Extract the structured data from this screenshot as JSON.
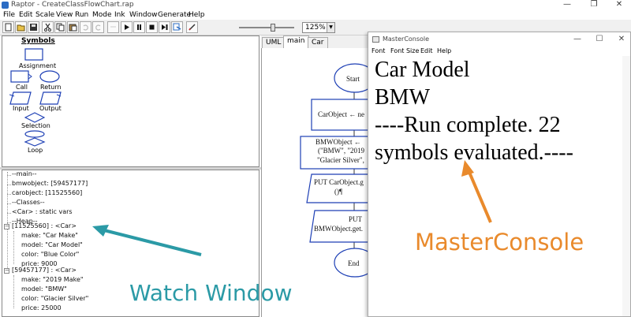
{
  "window": {
    "title": "Raptor - CreateClassFlowChart.rap"
  },
  "window_controls": {
    "minimize": "—",
    "maximize": "❐",
    "close": "✕"
  },
  "menu": [
    "File",
    "Edit",
    "Scale",
    "View",
    "Run",
    "Mode",
    "Ink",
    "Window",
    "Generate",
    "Help"
  ],
  "toolbar": {
    "buttons": [
      "new-icon",
      "open-icon",
      "save-icon",
      "cut-icon",
      "copy-icon",
      "paste-icon",
      "undo-icon",
      "redo-icon",
      "play-icon",
      "pause-icon",
      "stop-icon",
      "step-icon",
      "run-to-icon",
      "pen-icon"
    ],
    "zoom": "125%"
  },
  "symbols": {
    "heading": "Symbols",
    "items": [
      "Assignment",
      "Call",
      "Return",
      "Input",
      "Output",
      "Selection",
      "Loop"
    ]
  },
  "watch": {
    "lines": [
      "--main--",
      "bmwobject: [59457177]",
      "carobject: [11525560]",
      "--Classes--",
      "<Car> : static vars",
      "--Heap--",
      "[11525560] : <Car>",
      "make: \"Car Make\"",
      "model: \"Car Model\"",
      "color: \"Blue Color\"",
      "price: 9000",
      "[59457177] : <Car>",
      "make: \"2019 Make\"",
      "model: \"BMW\"",
      "color: \"Glacier Silver\"",
      "price: 25000"
    ]
  },
  "tabs": [
    "UML",
    "main",
    "Car"
  ],
  "flowchart": {
    "start": "Start",
    "box1": "CarObject ← ne",
    "box2_l1": "BMWObject ←",
    "box2_l2": "(\"BMW\", \"2019",
    "box2_l3": "\"Glacier Silver\",",
    "box3_l1": "PUT CarObject.g",
    "box3_l2": "()¶",
    "box4_l1": "PUT",
    "box4_l2": "BMWObject.get.",
    "end": "End"
  },
  "console": {
    "title": "MasterConsole",
    "menu": [
      "Font",
      "Font Size",
      "Edit",
      "Help"
    ],
    "output": [
      "Car Model",
      "BMW",
      "----Run complete.  22",
      "symbols evaluated.----"
    ]
  },
  "callouts": {
    "watch": "Watch Window",
    "console": "MasterConsole",
    "watch_color": "#2b9aa6",
    "console_color": "#e98a2c"
  }
}
